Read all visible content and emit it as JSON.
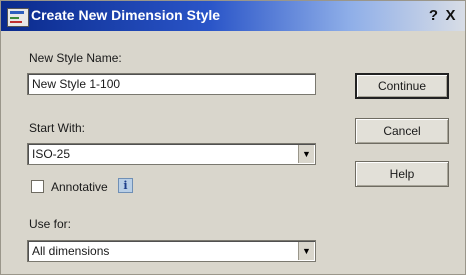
{
  "dialog": {
    "title": "Create New Dimension Style",
    "help_button": "?",
    "close_button": "X"
  },
  "form": {
    "new_style_name_label": "New Style Name:",
    "new_style_name_value": "New Style 1-100",
    "start_with_label": "Start With:",
    "start_with_value": "ISO-25",
    "annotative_label": "Annotative",
    "annotative_checked": false,
    "info_icon_glyph": "i",
    "use_for_label": "Use for:",
    "use_for_value": "All dimensions"
  },
  "buttons": {
    "continue": "Continue",
    "cancel": "Cancel",
    "help": "Help"
  },
  "icons": {
    "dropdown_arrow": "▼"
  }
}
